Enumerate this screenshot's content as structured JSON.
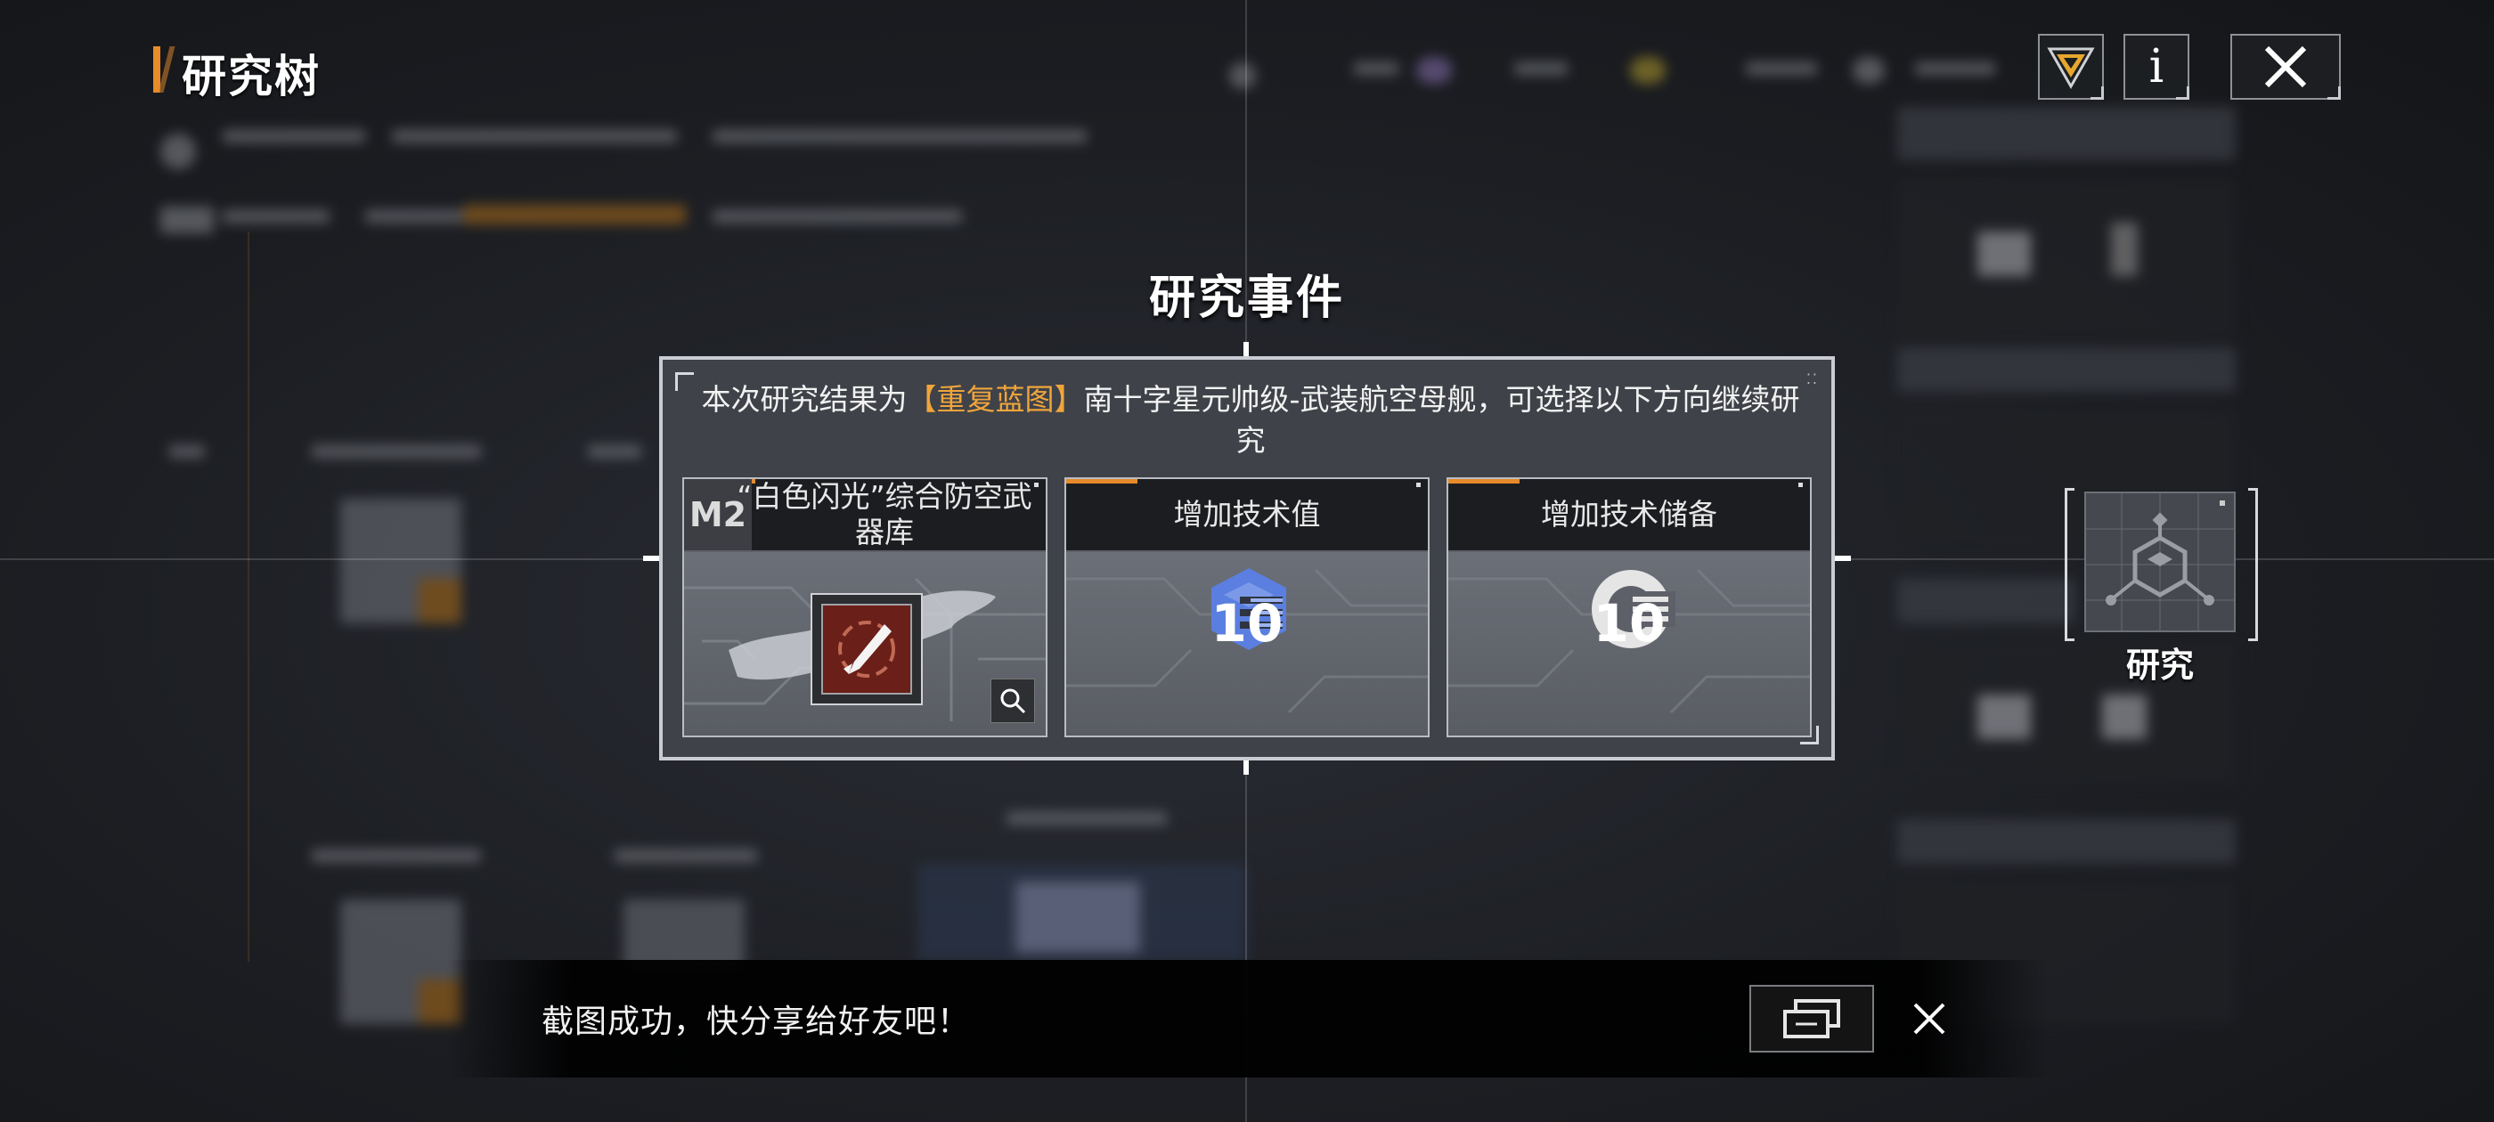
{
  "header": {
    "title": "研究树"
  },
  "top_buttons": {
    "icons": [
      "rank-badge-icon",
      "info-icon",
      "close-icon"
    ],
    "info_label": "i"
  },
  "dialog": {
    "title": "研究事件",
    "message_prefix": "本次研究结果为",
    "message_highlight": "【重复蓝图】",
    "message_suffix": "南十字星元帅级-武装航空母舰，可选择以下方向继续研究",
    "highlight_color": "#f0a53c",
    "options": [
      {
        "tier": "M2",
        "label": "“白色闪光”综合防空武器库",
        "icon": "missile-icon"
      },
      {
        "label": "增加技术值",
        "value": "10",
        "icon": "tech-value-icon",
        "icon_color": "#5b7fe0"
      },
      {
        "label": "增加技术储备",
        "value": "10",
        "icon": "tech-reserve-icon",
        "icon_color": "#e5e5e5"
      }
    ]
  },
  "research_node": {
    "label": "研究",
    "icon": "research-hex-icon"
  },
  "toast": {
    "message": "截图成功，快分享给好友吧！",
    "share_icon": "share-icon",
    "close_icon": "close-icon"
  },
  "accent_color": "#e88b2a"
}
